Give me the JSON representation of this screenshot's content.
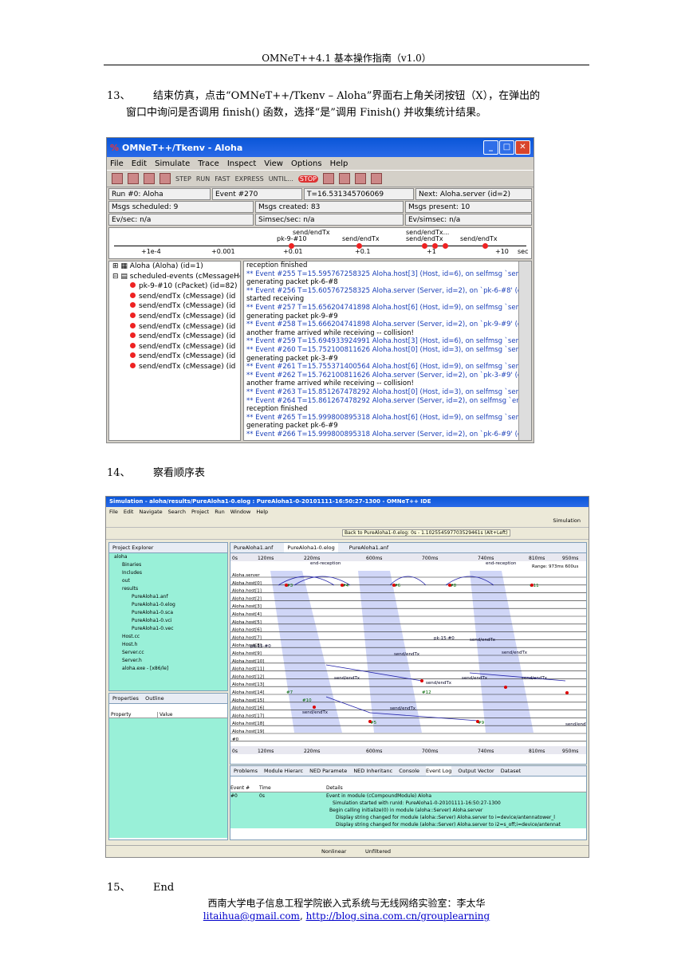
{
  "header": {
    "title": "OMNeT++4.1 基本操作指南（v1.0）"
  },
  "step13": {
    "num": "13、",
    "line1": "结束仿真，点击“OMNeT++/Tkenv – Aloha”界面右上角关闭按钮（X），在弹出的",
    "line2": "窗口中询问是否调用 finish() 函数，选择“是”调用 Finish() 并收集统计结果。"
  },
  "step14": {
    "num": "14、",
    "text": "察看顺序表"
  },
  "step15": {
    "num": "15、",
    "text": "End"
  },
  "footer": {
    "line1": "西南大学电子信息工程学院嵌入式系统与无线网络实验室：李太华",
    "email": "litaihua@gmail.com",
    "sep": ", ",
    "url": "http://blog.sina.com.cn/grouplearning"
  },
  "tkenv": {
    "title": "OMNeT++/Tkenv - Aloha",
    "menu": [
      "File",
      "Edit",
      "Simulate",
      "Trace",
      "Inspect",
      "View",
      "Options",
      "Help"
    ],
    "tools": [
      "STEP",
      "RUN",
      "FAST",
      "EXPRESS",
      "UNTIL...",
      "STOP"
    ],
    "run": "Run #0: Aloha",
    "event": "Event #270",
    "time": "T=16.531345706069",
    "next": "Next: Aloha.server (id=2)",
    "scheduled": "Msgs scheduled: 9",
    "created": "Msgs created: 83",
    "present": "Msgs present: 10",
    "evsec": "Ev/sec: n/a",
    "simsec": "Simsec/sec: n/a",
    "evsimsec": "Ev/simsec: n/a",
    "timeline_labels": [
      "send/endTx",
      "pk-9-#10",
      "send/endTx",
      "send/endTx...",
      "send/endTx",
      "send/endTx"
    ],
    "timeline_ticks": [
      "+1e-4",
      "+0.001",
      "+0.01",
      "+0.1",
      "+1",
      "+10",
      "sec"
    ],
    "tree": [
      "Aloha (Aloha) (id=1)",
      "scheduled-events (cMessageHe",
      "pk-9-#10 (cPacket) (id=82)",
      "send/endTx (cMessage) (id",
      "send/endTx (cMessage) (id",
      "send/endTx (cMessage) (id",
      "send/endTx (cMessage) (id",
      "send/endTx (cMessage) (id",
      "send/endTx (cMessage) (id",
      "send/endTx (cMessage) (id",
      "send/endTx (cMessage) (id"
    ],
    "log": [
      {
        "t": "reception finished",
        "ev": false
      },
      {
        "t": "** Event #255  T=15.595767258325  Aloha.host[3] (Host, id=6), on selfmsg `send/en",
        "ev": true
      },
      {
        "t": "generating packet pk-6-#8",
        "ev": false
      },
      {
        "t": "** Event #256  T=15.605767258325  Aloha.server (Server, id=2), on `pk-6-#8' (cPac",
        "ev": true
      },
      {
        "t": "started receiving",
        "ev": false
      },
      {
        "t": "** Event #257  T=15.656204741898  Aloha.host[6] (Host, id=9), on selfmsg `send/en",
        "ev": true
      },
      {
        "t": "generating packet pk-9-#9",
        "ev": false
      },
      {
        "t": "** Event #258  T=15.666204741898  Aloha.server (Server, id=2), on `pk-9-#9' (cPac",
        "ev": true
      },
      {
        "t": "another frame arrived while receiving -- collision!",
        "ev": false
      },
      {
        "t": "** Event #259  T=15.694933924991  Aloha.host[3] (Host, id=6), on selfmsg `send/en",
        "ev": true
      },
      {
        "t": "** Event #260  T=15.752100811626  Aloha.host[0] (Host, id=3), on selfmsg `send/en",
        "ev": true
      },
      {
        "t": "generating packet pk-3-#9",
        "ev": false
      },
      {
        "t": "** Event #261  T=15.755371400564  Aloha.host[6] (Host, id=9), on selfmsg `send/en",
        "ev": true
      },
      {
        "t": "** Event #262  T=15.762100811626  Aloha.server (Server, id=2), on `pk-3-#9' (cPac",
        "ev": true
      },
      {
        "t": "another frame arrived while receiving -- collision!",
        "ev": false
      },
      {
        "t": "** Event #263  T=15.851267478292  Aloha.host[0] (Host, id=3), on selfmsg `send/en",
        "ev": true
      },
      {
        "t": "** Event #264  T=15.861267478292  Aloha.server (Server, id=2), on selfmsg `end-re",
        "ev": true
      },
      {
        "t": "reception finished",
        "ev": false
      },
      {
        "t": "** Event #265  T=15.999800895318  Aloha.host[6] (Host, id=9), on selfmsg `send/en",
        "ev": true
      },
      {
        "t": "generating packet pk-6-#9",
        "ev": false
      },
      {
        "t": "** Event #266  T=15.999800895318  Aloha.server (Server, id=2), on `pk-6-#9' (cPac",
        "ev": true
      }
    ]
  },
  "ide": {
    "title": "Simulation - aloha/results/PureAloha1-0.elog : PureAloha1-0-20101111-16:50:27-1300 - OMNeT++ IDE",
    "menu": [
      "File",
      "Edit",
      "Navigate",
      "Search",
      "Project",
      "Run",
      "Window",
      "Help"
    ],
    "back": "Back to PureAloha1-0.elog: 0s - 1.102554597703529461s (Alt+Left)",
    "perspective": "Simulation",
    "explorer_tab": "Project Explorer",
    "explorer": [
      "aloha",
      "Binaries",
      "Includes",
      "out",
      "results",
      "PureAloha1.anf",
      "PureAloha1-0.elog",
      "PureAloha1-0.sca",
      "PureAloha1-0.vci",
      "PureAloha1-0.vec",
      "Host.cc",
      "Host.h",
      "Server.cc",
      "Server.h",
      "aloha.exe - [x86/le]"
    ],
    "props_tab": "Properties",
    "outline_tab": "Outline",
    "prop_cols": [
      "Property",
      "Value"
    ],
    "editor_tabs": [
      "PureAloha1.anf",
      "PureAloha1-0.elog",
      "PureAloha1.anf"
    ],
    "ticks": [
      "0s",
      "120ms",
      "220ms",
      "600ms",
      "700ms",
      "740ms",
      "810ms",
      "950ms"
    ],
    "range": "Range: 973ms 600us",
    "rows": [
      "Aloha.server",
      "Aloha.host[0]",
      "Aloha.host[1]",
      "Aloha.host[2]",
      "Aloha.host[3]",
      "Aloha.host[4]",
      "Aloha.host[5]",
      "Aloha.host[6]",
      "Aloha.host[7]",
      "Aloha.host[8]",
      "Aloha.host[9]",
      "Aloha.host[10]",
      "Aloha.host[11]",
      "Aloha.host[12]",
      "Aloha.host[13]",
      "Aloha.host[14]",
      "Aloha.host[15]",
      "Aloha.host[16]",
      "Aloha.host[17]",
      "Aloha.host[18]",
      "Aloha.host[19]",
      "#0"
    ],
    "seq_labels": [
      "end-reception",
      "end-reception",
      "#3",
      "#4",
      "#6",
      "#8",
      "#11",
      "pk-15-#0",
      "send/endTx",
      "pk-15-#0",
      "send/endTx",
      "send/endTx",
      "send/endTx",
      "send/endTx",
      "send/endTx",
      "#7",
      "#10",
      "#12",
      "send/endTx",
      "send/endTx",
      "send/endTx",
      "#5",
      "#9",
      "send/endTx"
    ],
    "bottom_tabs": [
      "Problems",
      "Module Hierarc",
      "NED Paramete",
      "NED Inheritanc",
      "Console",
      "Event Log",
      "Output Vector",
      "Dataset"
    ],
    "evlog_cols": [
      "Event #",
      "Time",
      "Details"
    ],
    "evlog": [
      {
        "n": "#0",
        "t": "0s",
        "d": "Event in module (cCompoundModule) Aloha"
      },
      {
        "n": "",
        "t": "",
        "d": "Simulation started with runId: PureAloha1-0-20101111-16:50:27-1300"
      },
      {
        "n": "",
        "t": "",
        "d": "Begin calling initialize(0) in module (aloha::Server) Aloha.server"
      },
      {
        "n": "",
        "t": "",
        "d": "Display string changed for module (aloha::Server) Aloha.server to i=device/antennatower_l"
      },
      {
        "n": "",
        "t": "",
        "d": "Display string changed for module (aloha::Server) Aloha.server to i2=s_off;i=device/antennat"
      }
    ],
    "status": [
      "Nonlinear",
      "Unfiltered"
    ]
  }
}
